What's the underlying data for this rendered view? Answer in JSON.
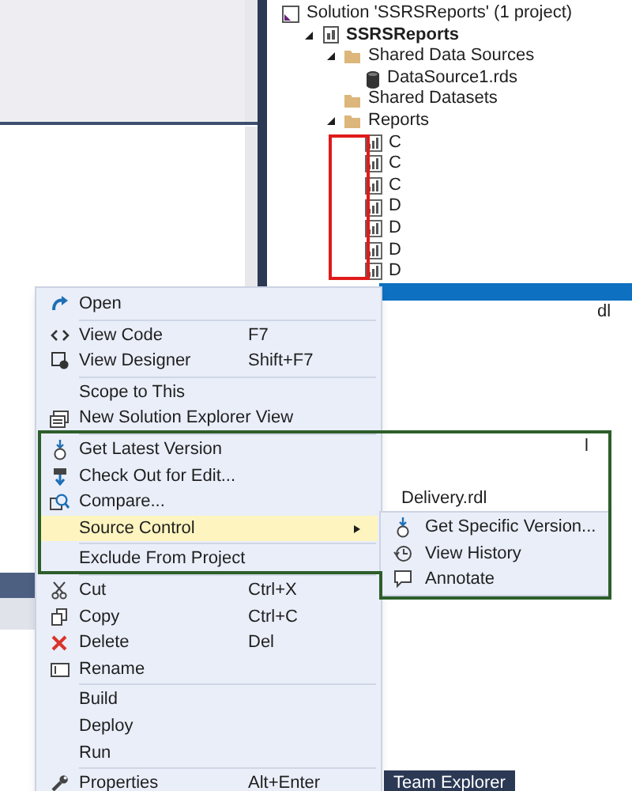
{
  "solution_explorer": {
    "tree": [
      {
        "label": "Solution 'SSRSReports' (1 project)",
        "kind": "solution",
        "children": [
          {
            "label": "SSRSReports",
            "kind": "project",
            "expanded": true,
            "children": [
              {
                "label": "Shared Data Sources",
                "kind": "folder",
                "expanded": true,
                "children": [
                  {
                    "label": "DataSource1.rds",
                    "kind": "datasource"
                  }
                ]
              },
              {
                "label": "Shared Datasets",
                "kind": "folder",
                "expanded": false
              },
              {
                "label": "Reports",
                "kind": "folder",
                "expanded": true,
                "children": [
                  {
                    "label": "C",
                    "kind": "report"
                  },
                  {
                    "label": "C",
                    "kind": "report"
                  },
                  {
                    "label": "C",
                    "kind": "report"
                  },
                  {
                    "label": "D",
                    "kind": "report"
                  },
                  {
                    "label": "D",
                    "kind": "report"
                  },
                  {
                    "label": "D",
                    "kind": "report"
                  },
                  {
                    "label": "D",
                    "kind": "report"
                  }
                ]
              }
            ]
          }
        ]
      }
    ]
  },
  "background_fragments": [
    "dl",
    "l",
    "Delivery.rdl"
  ],
  "team_explorer_tab": "Team Explorer",
  "context_menu": {
    "items": [
      {
        "kind": "item",
        "label": "Open",
        "selected": false
      },
      {
        "kind": "separator"
      },
      {
        "kind": "item",
        "label": "View Code",
        "shortcut": "F7",
        "selected": false
      },
      {
        "kind": "item",
        "label": "View Designer",
        "shortcut": "Shift+F7",
        "selected": false
      },
      {
        "kind": "separator"
      },
      {
        "kind": "item",
        "label": "Scope to This",
        "selected": false
      },
      {
        "kind": "item",
        "label": "New Solution Explorer View",
        "selected": false
      },
      {
        "kind": "separator"
      },
      {
        "kind": "item",
        "label": "Get Latest Version",
        "selected": false
      },
      {
        "kind": "item",
        "label": "Check Out for Edit...",
        "selected": false
      },
      {
        "kind": "item",
        "label": "Compare...",
        "selected": false
      },
      {
        "kind": "item",
        "label": "Source Control",
        "selected": true,
        "submenu": true
      },
      {
        "kind": "separator"
      },
      {
        "kind": "item",
        "label": "Exclude From Project",
        "selected": false
      },
      {
        "kind": "separator"
      },
      {
        "kind": "item",
        "label": "Cut",
        "shortcut": "Ctrl+X",
        "selected": false
      },
      {
        "kind": "item",
        "label": "Copy",
        "shortcut": "Ctrl+C",
        "selected": false
      },
      {
        "kind": "item",
        "label": "Delete",
        "shortcut": "Del",
        "selected": false
      },
      {
        "kind": "item",
        "label": "Rename",
        "selected": false
      },
      {
        "kind": "separator"
      },
      {
        "kind": "item",
        "label": "Build",
        "selected": false
      },
      {
        "kind": "item",
        "label": "Deploy",
        "selected": false
      },
      {
        "kind": "item",
        "label": "Run",
        "selected": false
      },
      {
        "kind": "separator"
      },
      {
        "kind": "item",
        "label": "Properties",
        "shortcut": "Alt+Enter",
        "selected": false
      }
    ]
  },
  "submenu": {
    "items": [
      {
        "label": "Get Specific Version...",
        "selected": false
      },
      {
        "label": "View History",
        "selected": false
      },
      {
        "label": "Annotate",
        "selected": false
      }
    ]
  },
  "annotations": [
    {
      "color": "#e01b1b"
    },
    {
      "color": "#2d5e2a"
    }
  ]
}
